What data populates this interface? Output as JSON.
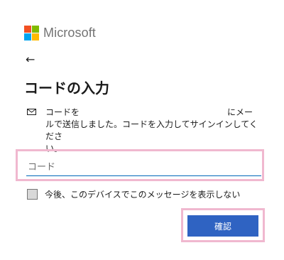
{
  "brand": {
    "name": "Microsoft",
    "colors": [
      "#f25022",
      "#7fba00",
      "#00a4ef",
      "#ffb900"
    ]
  },
  "nav": {
    "back_icon": "←"
  },
  "page": {
    "title": "コードの入力"
  },
  "message": {
    "icon": "mail-icon",
    "part1": "コードを",
    "part2": "にメー",
    "line2": "ルで送信しました。コードを入力してサインインしてくださ",
    "line3": "い。"
  },
  "code_field": {
    "placeholder": "コード",
    "value": ""
  },
  "remember": {
    "label": "今後、このデバイスでこのメッセージを表示しない",
    "checked": false
  },
  "actions": {
    "confirm_label": "確認"
  },
  "theme": {
    "accent": "#2f63c2",
    "highlight": "#f0b8cf",
    "input_underline": "#0067b8"
  }
}
